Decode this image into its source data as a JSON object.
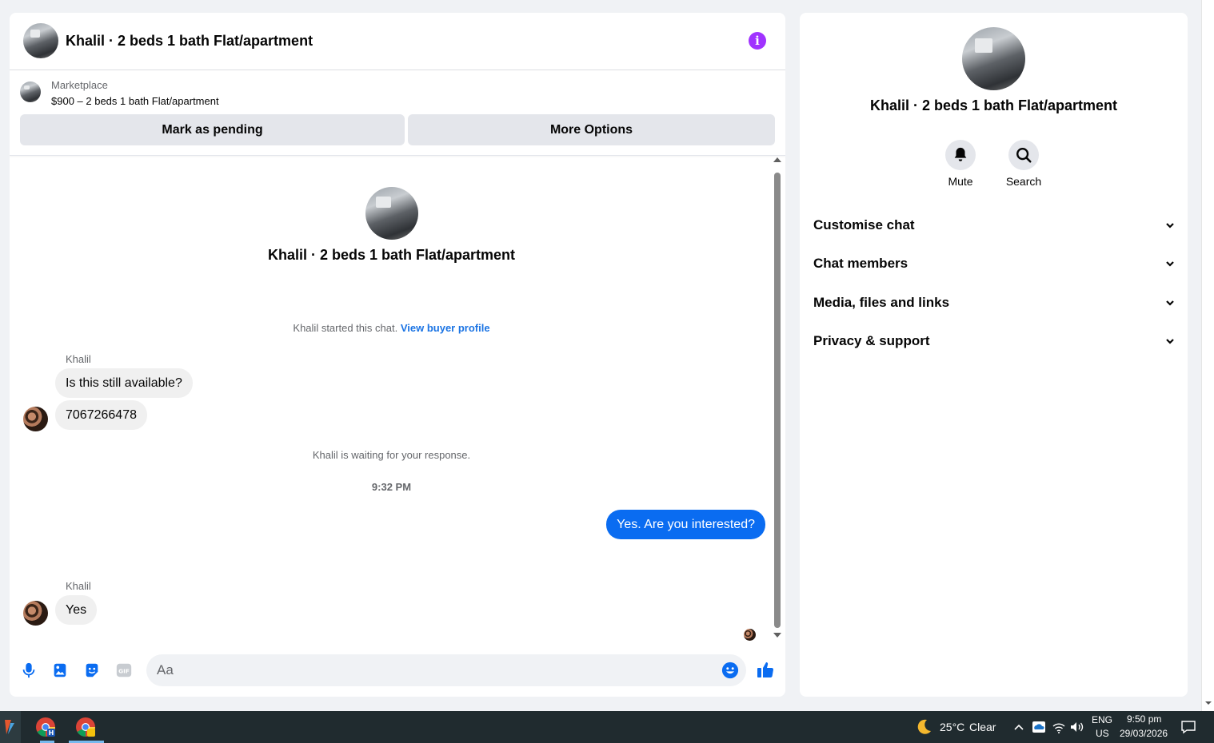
{
  "chat": {
    "title": "Khalil · 2 beds 1 bath Flat/apartment",
    "marketplace": {
      "label": "Marketplace",
      "listing": "$900 – 2 beds 1 bath Flat/apartment",
      "mark_pending": "Mark as pending",
      "more_options": "More Options"
    },
    "intro_title": "Khalil · 2 beds 1 bath Flat/apartment",
    "started_text": "Khalil started this chat.",
    "view_buyer_link": "View buyer profile",
    "messages": [
      {
        "sender": "Khalil",
        "text": "Is this still available?"
      },
      {
        "text": "7067266478"
      },
      {
        "system": "Khalil is waiting for your response."
      },
      {
        "time": "9:32 PM"
      },
      {
        "outgoing": "Yes. Are you interested?"
      },
      {
        "sender": "Khalil",
        "text": "Yes"
      }
    ],
    "composer_placeholder": "Aa"
  },
  "details": {
    "title": "Khalil · 2 beds 1 bath Flat/apartment",
    "actions": [
      "Mute",
      "Search"
    ],
    "sections": [
      "Customise chat",
      "Chat members",
      "Media, files and links",
      "Privacy & support"
    ]
  },
  "taskbar": {
    "weather_temp": "25°C",
    "weather_cond": "Clear",
    "lang_top": "ENG",
    "lang_bottom": "US",
    "time": "9:50 pm",
    "date": "29/03/2026"
  },
  "colors": {
    "accent_purple": "#a033ff",
    "messenger_blue": "#0a6cf1",
    "link_blue": "#1b74e4"
  },
  "icons": [
    "info-icon",
    "microphone-icon",
    "photo-icon",
    "sticker-icon",
    "gif-icon",
    "emoji-icon",
    "like-thumb-icon",
    "bell-icon",
    "search-icon",
    "chevron-down-icon",
    "moon-icon",
    "chrome-icon",
    "notification-icon"
  ]
}
